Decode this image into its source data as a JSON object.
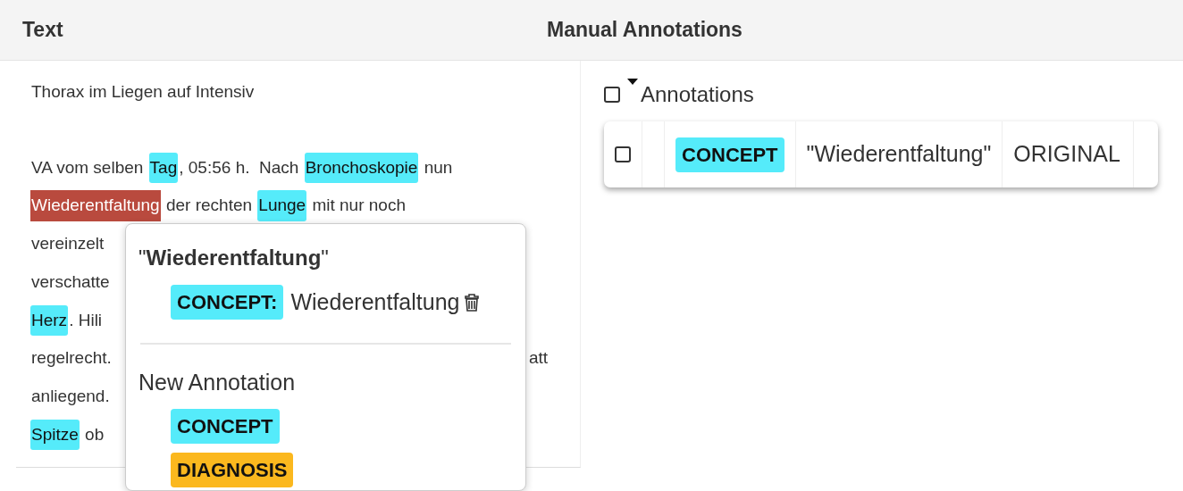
{
  "headers": [
    "Text",
    "Manual Annotations"
  ],
  "paragraphs": [
    [
      [
        {
          "text": "Thorax im Liegen auf Intensiv",
          "annotated": false,
          "selected": false
        }
      ]
    ],
    [
      [
        {
          "text": "VA vom selben ",
          "annotated": false,
          "selected": false
        },
        {
          "text": "Tag",
          "annotated": true,
          "selected": false
        },
        {
          "text": ", 05:56 h.  Nach ",
          "annotated": false,
          "selected": false
        },
        {
          "text": "Bronchoskopie",
          "annotated": true,
          "selected": false
        },
        {
          "text": " nun",
          "annotated": false,
          "selected": false
        }
      ],
      [
        {
          "text": "Wiederentfaltung",
          "annotated": true,
          "selected": true
        },
        {
          "text": " der rechten ",
          "annotated": false,
          "selected": false
        },
        {
          "text": "Lunge",
          "annotated": true,
          "selected": false
        },
        {
          "text": " mit nur noch",
          "annotated": false,
          "selected": false
        }
      ],
      [
        {
          "text": "vereinzelt",
          "annotated": false,
          "selected": false
        }
      ],
      [
        {
          "text": "verschatte",
          "annotated": false,
          "selected": false
        }
      ],
      [
        {
          "text": "Herz",
          "annotated": true,
          "selected": false
        },
        {
          "text": ". Hili",
          "annotated": false,
          "selected": false
        }
      ],
      {
        "left": [
          {
            "text": "regelrecht.",
            "annotated": false,
            "selected": false
          }
        ],
        "right": [
          {
            "text": "att",
            "annotated": false,
            "selected": false
          }
        ]
      },
      [
        {
          "text": "anliegend.",
          "annotated": false,
          "selected": false
        }
      ],
      [
        {
          "text": "Spitze",
          "annotated": true,
          "selected": false
        },
        {
          "text": " ob",
          "annotated": false,
          "selected": false
        }
      ]
    ]
  ],
  "annotations": {
    "label": "Annotations",
    "checked": false,
    "rows": [
      {
        "checked": false,
        "type": "CONCEPT",
        "color": "#55ebfa",
        "text": "\"Wiederentfaltung\"",
        "source": "ORIGINAL"
      }
    ]
  },
  "popover": {
    "title": "\"**Wiederentfaltung**\"",
    "existing": [
      {
        "type": "CONCEPT:",
        "color": "#55ebfa",
        "value": "Wiederentfaltung"
      }
    ],
    "new_label": "New Annotation",
    "new_types": [
      {
        "type": "CONCEPT",
        "color": "#55ebfa"
      },
      {
        "type": "DIAGNOSIS",
        "color": "#fbb81e"
      }
    ]
  }
}
